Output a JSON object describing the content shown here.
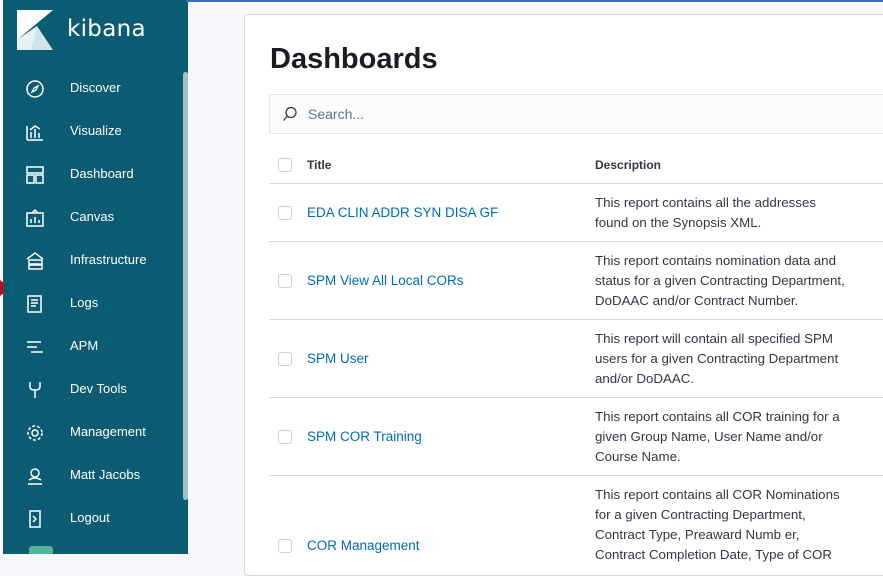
{
  "app": {
    "name": "kibana"
  },
  "colors": {
    "sidebar": "#0b5c72",
    "link": "#006bb4",
    "accent_green": "#54b399"
  },
  "sidebar": {
    "items": [
      {
        "label": "Discover",
        "icon": "compass-icon"
      },
      {
        "label": "Visualize",
        "icon": "bar-chart-icon"
      },
      {
        "label": "Dashboard",
        "icon": "dashboard-icon"
      },
      {
        "label": "Canvas",
        "icon": "canvas-icon"
      },
      {
        "label": "Infrastructure",
        "icon": "infrastructure-icon"
      },
      {
        "label": "Logs",
        "icon": "logs-icon"
      },
      {
        "label": "APM",
        "icon": "apm-icon"
      },
      {
        "label": "Dev Tools",
        "icon": "wrench-icon"
      },
      {
        "label": "Management",
        "icon": "gear-icon"
      },
      {
        "label": "Matt Jacobs",
        "icon": "user-icon"
      },
      {
        "label": "Logout",
        "icon": "logout-icon"
      }
    ]
  },
  "main": {
    "title": "Dashboards",
    "search": {
      "placeholder": "Search...",
      "value": ""
    },
    "table": {
      "columns": [
        "Title",
        "Description"
      ],
      "rows": [
        {
          "title": "EDA CLIN ADDR SYN DISA GF",
          "description_lines": [
            "This report contains all the addresses",
            "found on the Synopsis XML."
          ]
        },
        {
          "title": "SPM View All Local CORs",
          "description_lines": [
            "This report contains nomination data and",
            "status for a given Contracting Department,",
            "DoDAAC and/or Contract Number."
          ]
        },
        {
          "title": "SPM User",
          "description_lines": [
            "This report will contain all specified SPM",
            "users for a given Contracting Department",
            "and/or DoDAAC."
          ]
        },
        {
          "title": "SPM COR Training",
          "description_lines": [
            "This report contains all COR training for a",
            "given Group Name, User Name and/or",
            "Course Name."
          ]
        },
        {
          "title": "COR Management",
          "description_lines": [
            "This report contains all COR Nominations",
            "for a given Contracting Department,",
            "Contract Type, Preaward Numb er,",
            "Contract Completion Date, Type of COR"
          ]
        }
      ]
    }
  }
}
